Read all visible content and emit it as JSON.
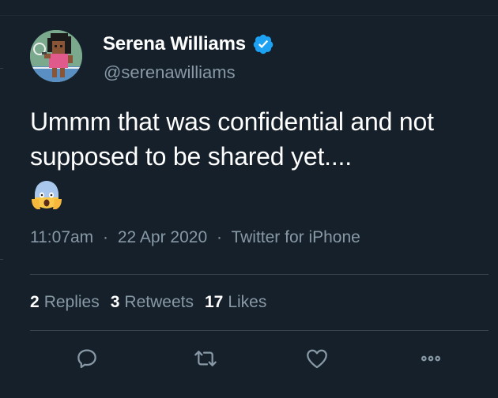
{
  "colors": {
    "background": "#15202b",
    "text_primary": "#ffffff",
    "text_secondary": "#8899a6",
    "verified_blue": "#1da1f2",
    "divider": "#38444d"
  },
  "author": {
    "name": "Serena Williams",
    "handle": "@serenawilliams",
    "verified": true,
    "avatar_icon": "avatar-tennis-player-icon"
  },
  "tweet": {
    "text": "Ummm that was confidential and not supposed to be shared yet....",
    "emoji": "😱",
    "emoji_icon": "face-screaming-in-fear-icon"
  },
  "meta": {
    "time": "11:07am",
    "separator": "·",
    "date": "22 Apr 2020",
    "source": "Twitter for iPhone"
  },
  "stats": [
    {
      "count": "2",
      "label": "Replies"
    },
    {
      "count": "3",
      "label": "Retweets"
    },
    {
      "count": "17",
      "label": "Likes"
    }
  ],
  "actions": [
    {
      "name": "reply",
      "icon": "reply-icon"
    },
    {
      "name": "retweet",
      "icon": "retweet-icon"
    },
    {
      "name": "like",
      "icon": "heart-icon"
    },
    {
      "name": "more",
      "icon": "more-icon"
    }
  ]
}
